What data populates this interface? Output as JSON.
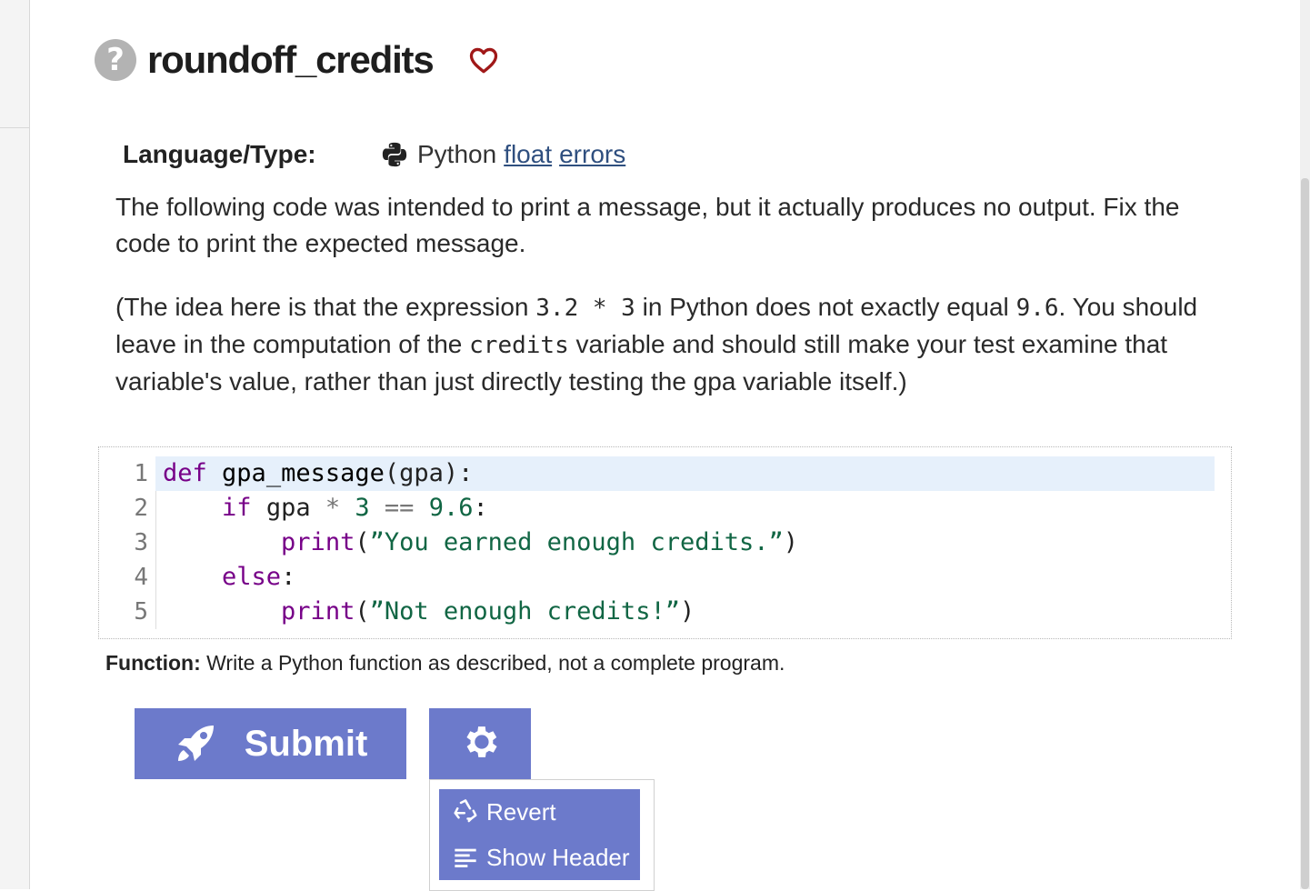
{
  "problem": {
    "title": "roundoff_credits",
    "help_icon": "question-circle-icon",
    "favorite_icon": "heart-outline-icon"
  },
  "meta": {
    "language_label": "Language/Type:",
    "language_icon": "python-icon",
    "language": "Python",
    "tags": [
      "float",
      "errors"
    ]
  },
  "description": {
    "para1": "The following code was intended to print a message, but it actually produces no output. Fix the code to print the expected message.",
    "para2_parts": {
      "p1": "(The idea here is that the expression ",
      "c1": "3.2 * 3",
      "p2": " in Python does not exactly equal ",
      "c2": "9.6",
      "p3": ". You should leave in the computation of the ",
      "c3": "credits",
      "p4": " variable and should still make your test examine that variable's value, rather than just directly testing the gpa variable itself.)"
    }
  },
  "editor": {
    "line_numbers": [
      "1",
      "2",
      "3",
      "4",
      "5"
    ],
    "active_line": 1
  },
  "function_note": {
    "label": "Function:",
    "text": " Write a Python function as described, not a complete program."
  },
  "buttons": {
    "submit_label": "Submit",
    "submit_icon": "rocket-icon",
    "settings_icon": "gear-icon"
  },
  "settings_menu": {
    "items": [
      {
        "label": "Revert",
        "icon": "recycle-icon"
      },
      {
        "label": "Show Header",
        "icon": "align-left-icon"
      }
    ]
  },
  "colors": {
    "accent": "#6c7acb",
    "keyword": "#770088",
    "string": "#116644",
    "tag_link": "#2f4f7f",
    "heart": "#a01818",
    "active_line": "#e6f0fb"
  }
}
